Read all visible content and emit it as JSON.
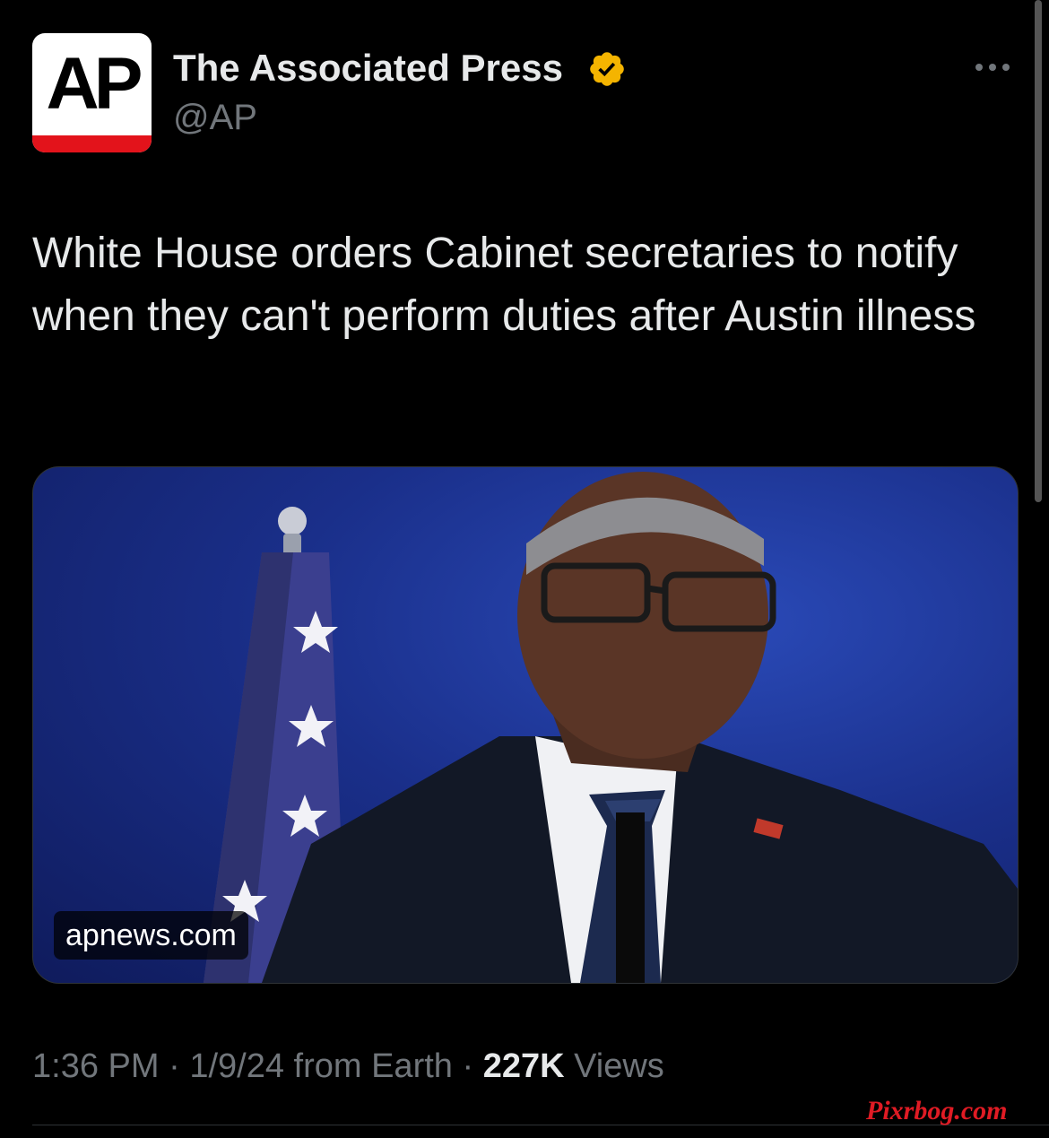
{
  "author": {
    "display_name": "The Associated Press",
    "handle": "@AP",
    "avatar_text": "AP",
    "verified_badge_color": "#f4b400"
  },
  "tweet": {
    "text": "White House orders Cabinet secretaries to notify when they can't perform duties after Austin illness"
  },
  "card": {
    "domain": "apnews.com"
  },
  "meta": {
    "time": "1:36 PM",
    "date": "1/9/24",
    "source": "from Earth",
    "separator": "·",
    "views_count": "227K",
    "views_label": "Views"
  },
  "watermark": "Pixrbog.com",
  "icons": {
    "more": "more-icon",
    "verified": "verified-badge-icon"
  },
  "colors": {
    "background": "#000000",
    "text_primary": "#e7e9ea",
    "text_secondary": "#71767b",
    "ap_red": "#e3131b"
  }
}
